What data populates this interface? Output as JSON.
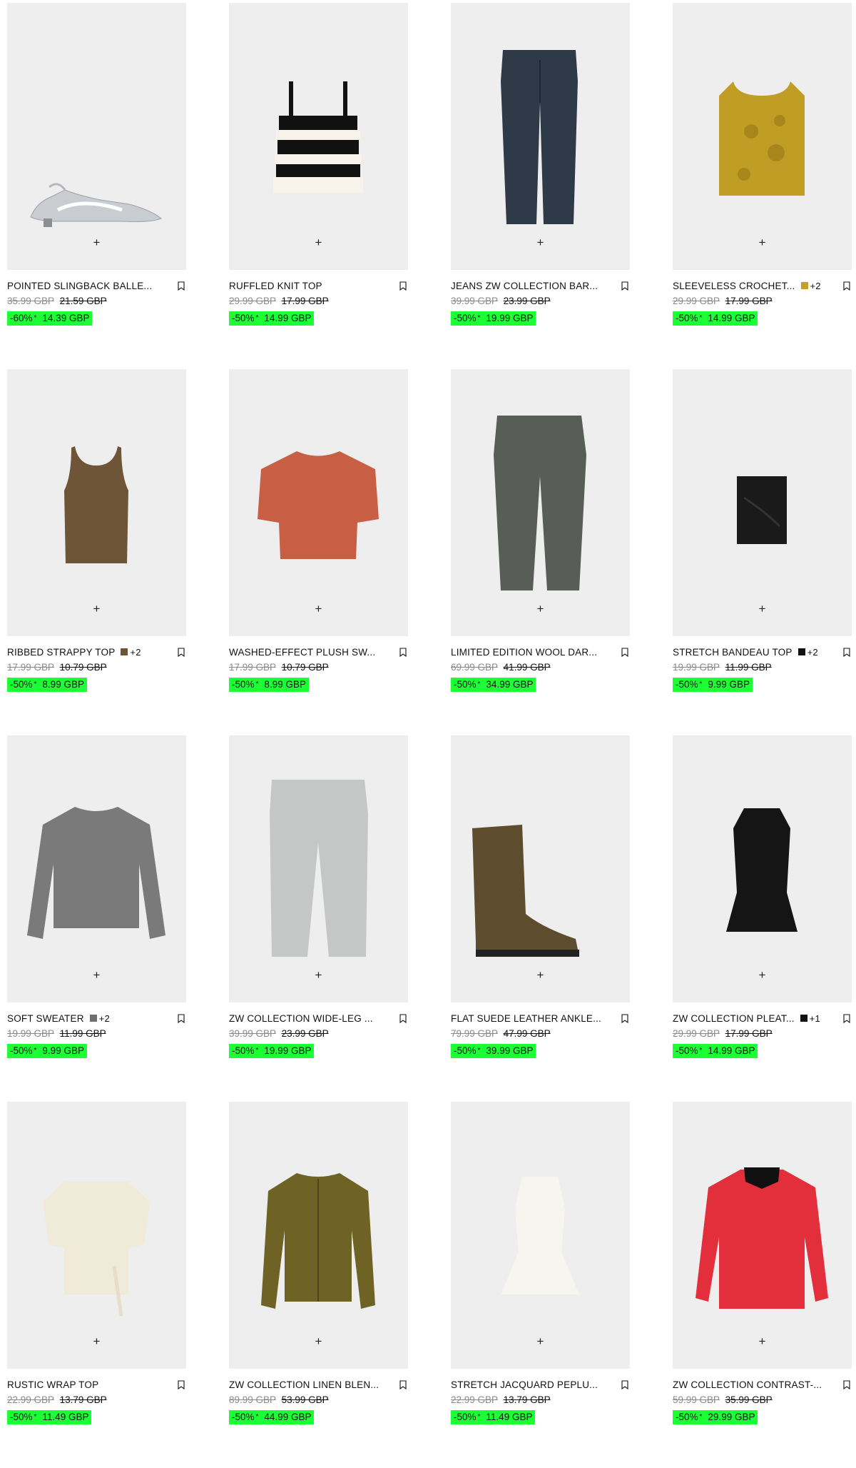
{
  "colors": {
    "sale_bg": "#1dff35",
    "image_bg": "#eeeeee"
  },
  "products": [
    {
      "name": "POINTED SLINGBACK BALLERINA FLATS",
      "display_name": "POINTED SLINGBACK BALLE...",
      "orig": "35.99 GBP",
      "was": "21.59 GBP",
      "discount": "-60%",
      "star": "*",
      "sale": "14.39 GBP",
      "swatch": "",
      "extra": "",
      "icon": "slingback-flat-shoe"
    },
    {
      "name": "RUFFLED KNIT TOP",
      "display_name": "RUFFLED KNIT TOP",
      "orig": "29.99 GBP",
      "was": "17.99 GBP",
      "discount": "-50%",
      "star": "*",
      "sale": "14.99 GBP",
      "swatch": "",
      "extra": "",
      "icon": "striped-ruffle-top"
    },
    {
      "name": "JEANS ZW COLLECTION BARREL",
      "display_name": "JEANS ZW COLLECTION BAR...",
      "orig": "39.99 GBP",
      "was": "23.99 GBP",
      "discount": "-50%",
      "star": "*",
      "sale": "19.99 GBP",
      "swatch": "",
      "extra": "",
      "icon": "dark-jeans"
    },
    {
      "name": "SLEEVELESS CROCHET TOP",
      "display_name": "SLEEVELESS CROCHET...",
      "orig": "29.99 GBP",
      "was": "17.99 GBP",
      "discount": "-50%",
      "star": "*",
      "sale": "14.99 GBP",
      "swatch": "#c4a126",
      "extra": "+2",
      "icon": "crochet-vest"
    },
    {
      "name": "RIBBED STRAPPY TOP",
      "display_name": "RIBBED STRAPPY TOP",
      "orig": "17.99 GBP",
      "was": "10.79 GBP",
      "discount": "-50%",
      "star": "*",
      "sale": "8.99 GBP",
      "swatch": "#6d5338",
      "extra": "+2",
      "icon": "tank-top"
    },
    {
      "name": "WASHED-EFFECT PLUSH SWEATER",
      "display_name": "WASHED-EFFECT PLUSH SW...",
      "orig": "17.99 GBP",
      "was": "10.79 GBP",
      "discount": "-50%",
      "star": "*",
      "sale": "8.99 GBP",
      "swatch": "",
      "extra": "",
      "icon": "tshirt"
    },
    {
      "name": "LIMITED EDITION WOOL DARTED TROUSERS",
      "display_name": "LIMITED EDITION WOOL DAR...",
      "orig": "69.99 GBP",
      "was": "41.99 GBP",
      "discount": "-50%",
      "star": "*",
      "sale": "34.99 GBP",
      "swatch": "",
      "extra": "",
      "icon": "wool-trousers"
    },
    {
      "name": "STRETCH BANDEAU TOP",
      "display_name": "STRETCH BANDEAU TOP",
      "orig": "19.99 GBP",
      "was": "11.99 GBP",
      "discount": "-50%",
      "star": "*",
      "sale": "9.99 GBP",
      "swatch": "#111111",
      "extra": "+2",
      "icon": "bandeau-top"
    },
    {
      "name": "SOFT SWEATER",
      "display_name": "SOFT SWEATER",
      "orig": "19.99 GBP",
      "was": "11.99 GBP",
      "discount": "-50%",
      "star": "*",
      "sale": "9.99 GBP",
      "swatch": "#6f6f6f",
      "extra": "+2",
      "icon": "sweater"
    },
    {
      "name": "ZW COLLECTION WIDE-LEG JEANS",
      "display_name": "ZW COLLECTION WIDE-LEG ...",
      "orig": "39.99 GBP",
      "was": "23.99 GBP",
      "discount": "-50%",
      "star": "*",
      "sale": "19.99 GBP",
      "swatch": "",
      "extra": "",
      "icon": "light-jeans"
    },
    {
      "name": "FLAT SUEDE LEATHER ANKLE BOOTS",
      "display_name": "FLAT SUEDE LEATHER ANKLE...",
      "orig": "79.99 GBP",
      "was": "47.99 GBP",
      "discount": "-50%",
      "star": "*",
      "sale": "39.99 GBP",
      "swatch": "",
      "extra": "",
      "icon": "suede-boot"
    },
    {
      "name": "ZW COLLECTION PLEATED TOP",
      "display_name": "ZW COLLECTION PLEAT...",
      "orig": "29.99 GBP",
      "was": "17.99 GBP",
      "discount": "-50%",
      "star": "*",
      "sale": "14.99 GBP",
      "swatch": "#111111",
      "extra": "+1",
      "icon": "peplum-halter-top"
    },
    {
      "name": "RUSTIC WRAP TOP",
      "display_name": "RUSTIC WRAP TOP",
      "orig": "22.99 GBP",
      "was": "13.79 GBP",
      "discount": "-50%",
      "star": "*",
      "sale": "11.49 GBP",
      "swatch": "",
      "extra": "",
      "icon": "wrap-top"
    },
    {
      "name": "ZW COLLECTION LINEN BLEND JACKET",
      "display_name": "ZW COLLECTION LINEN BLEN...",
      "orig": "89.99 GBP",
      "was": "53.99 GBP",
      "discount": "-50%",
      "star": "*",
      "sale": "44.99 GBP",
      "swatch": "",
      "extra": "",
      "icon": "olive-jacket"
    },
    {
      "name": "STRETCH JACQUARD PEPLUM TOP",
      "display_name": "STRETCH JACQUARD PEPLU...",
      "orig": "22.99 GBP",
      "was": "13.79 GBP",
      "discount": "-50%",
      "star": "*",
      "sale": "11.49 GBP",
      "swatch": "",
      "extra": "",
      "icon": "white-peplum-top"
    },
    {
      "name": "ZW COLLECTION CONTRAST-COLLAR JACKET",
      "display_name": "ZW COLLECTION CONTRAST-...",
      "orig": "59.99 GBP",
      "was": "35.99 GBP",
      "discount": "-50%",
      "star": "*",
      "sale": "29.99 GBP",
      "swatch": "",
      "extra": "",
      "icon": "red-jacket"
    }
  ],
  "ui": {
    "add_label": "+",
    "bookmark_icon": "bookmark-icon",
    "add_icon": "plus-icon"
  }
}
